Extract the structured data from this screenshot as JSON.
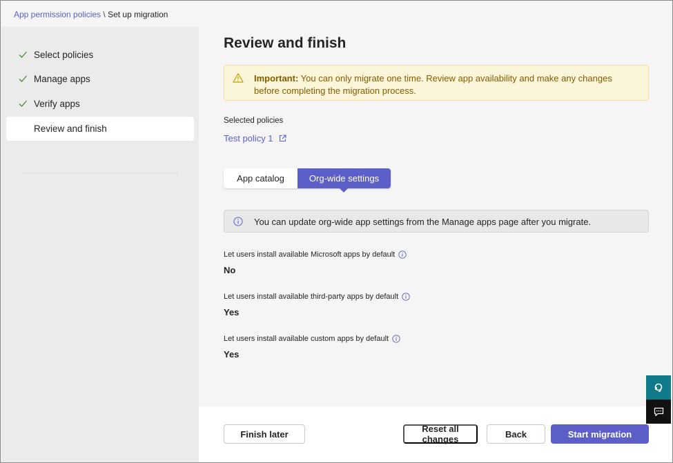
{
  "breadcrumb": {
    "parent": "App permission policies",
    "separator": " \\ ",
    "current": "Set up migration"
  },
  "sidebar": {
    "steps": [
      {
        "label": "Select policies",
        "completed": true
      },
      {
        "label": "Manage apps",
        "completed": true
      },
      {
        "label": "Verify apps",
        "completed": true
      },
      {
        "label": "Review and finish",
        "completed": false,
        "active": true
      }
    ]
  },
  "main": {
    "title": "Review and finish",
    "warning": {
      "icon": "warning-icon",
      "strong": "Important:",
      "text": " You can only migrate one time. Review app availability and make any changes before completing the migration process."
    },
    "selected_policies_label": "Selected policies",
    "policy_link": "Test policy 1",
    "tabs": [
      {
        "label": "App catalog",
        "selected": false
      },
      {
        "label": "Org-wide settings",
        "selected": true
      }
    ],
    "info": {
      "icon": "info-icon",
      "text": "You can update org-wide app settings from the Manage apps page after you migrate."
    },
    "settings": [
      {
        "label": "Let users install available Microsoft apps by default",
        "value": "No"
      },
      {
        "label": "Let users install available third-party apps by default",
        "value": "Yes"
      },
      {
        "label": "Let users install available custom apps by default",
        "value": "Yes"
      }
    ]
  },
  "footer": {
    "finish_later": "Finish later",
    "reset": "Reset all changes",
    "back": "Back",
    "start": "Start migration"
  },
  "colors": {
    "accent": "#5b5fc7",
    "warning_bg": "#fbf6d9",
    "warning_text": "#835b00",
    "help_button": "#0f7b8a"
  }
}
